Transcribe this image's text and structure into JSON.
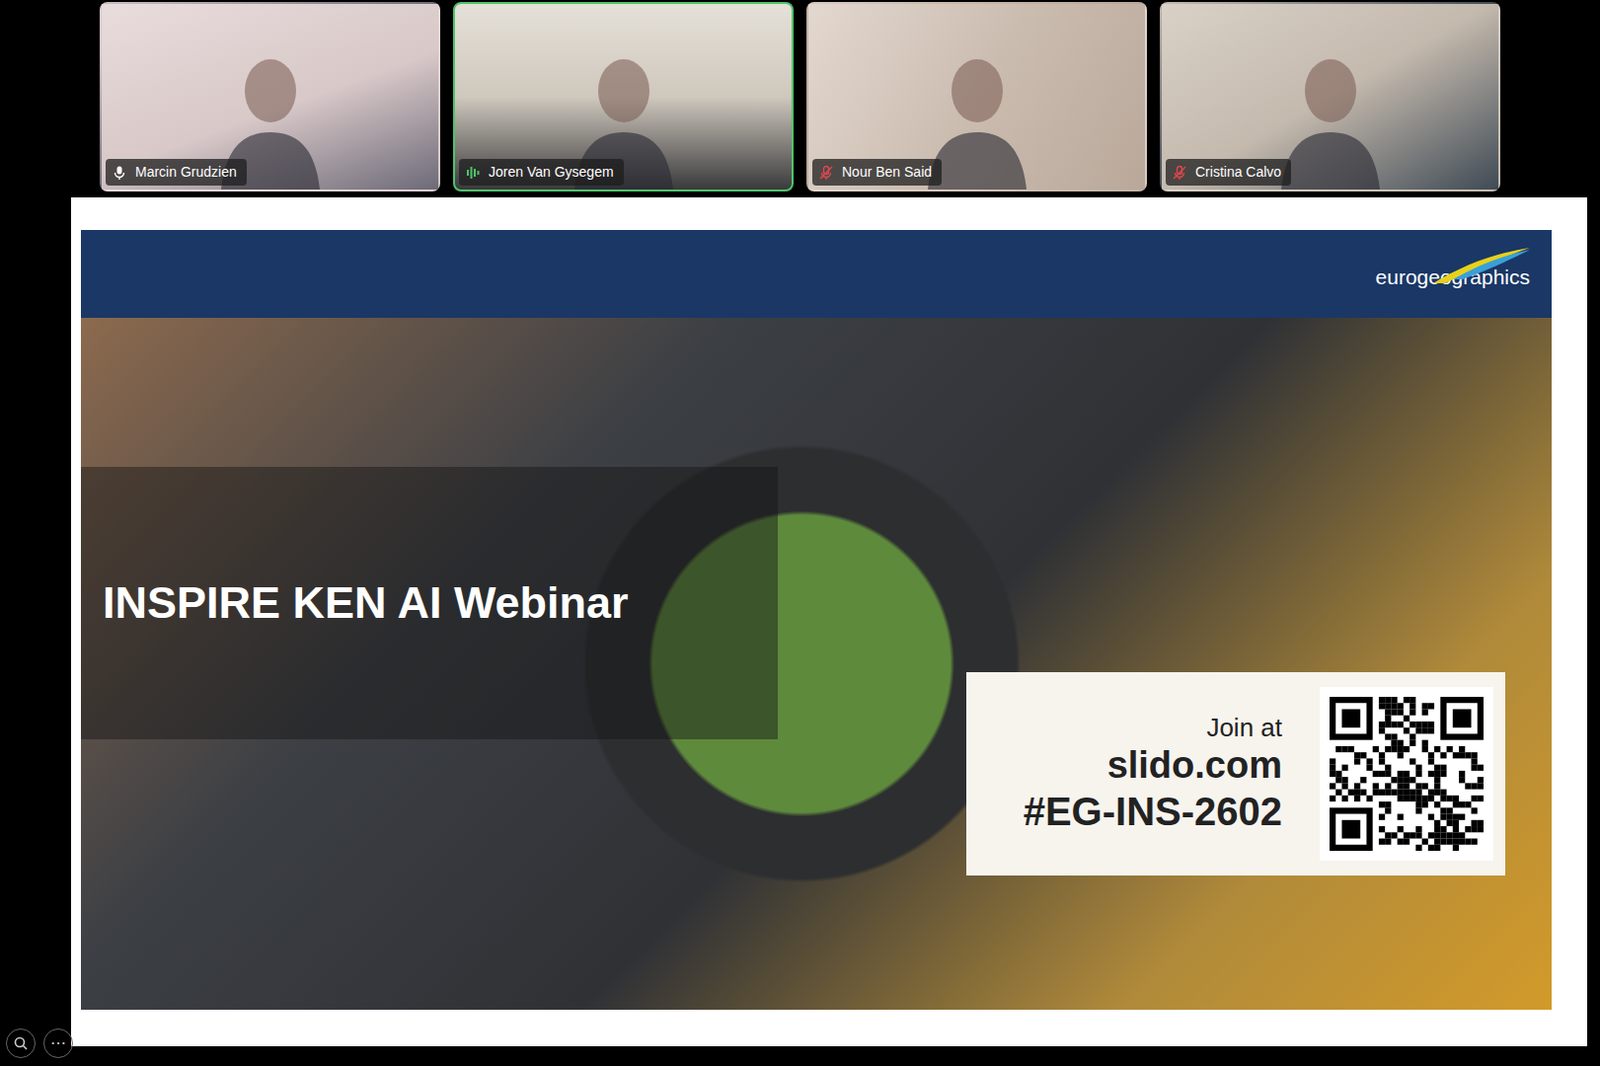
{
  "participants": [
    {
      "name": "Marcin Grudzien",
      "muted": false,
      "speaking": false
    },
    {
      "name": "Joren Van Gysegem",
      "muted": false,
      "speaking": true
    },
    {
      "name": "Nour Ben Said",
      "muted": true,
      "speaking": false
    },
    {
      "name": "Cristina Calvo",
      "muted": true,
      "speaking": false
    }
  ],
  "slide": {
    "logo": "eurogeographics",
    "title": "INSPIRE KEN AI Webinar",
    "join": {
      "label": "Join at",
      "site": "slido.com",
      "code": "#EG-INS-2602"
    }
  },
  "controls": {
    "more": "⋯"
  }
}
